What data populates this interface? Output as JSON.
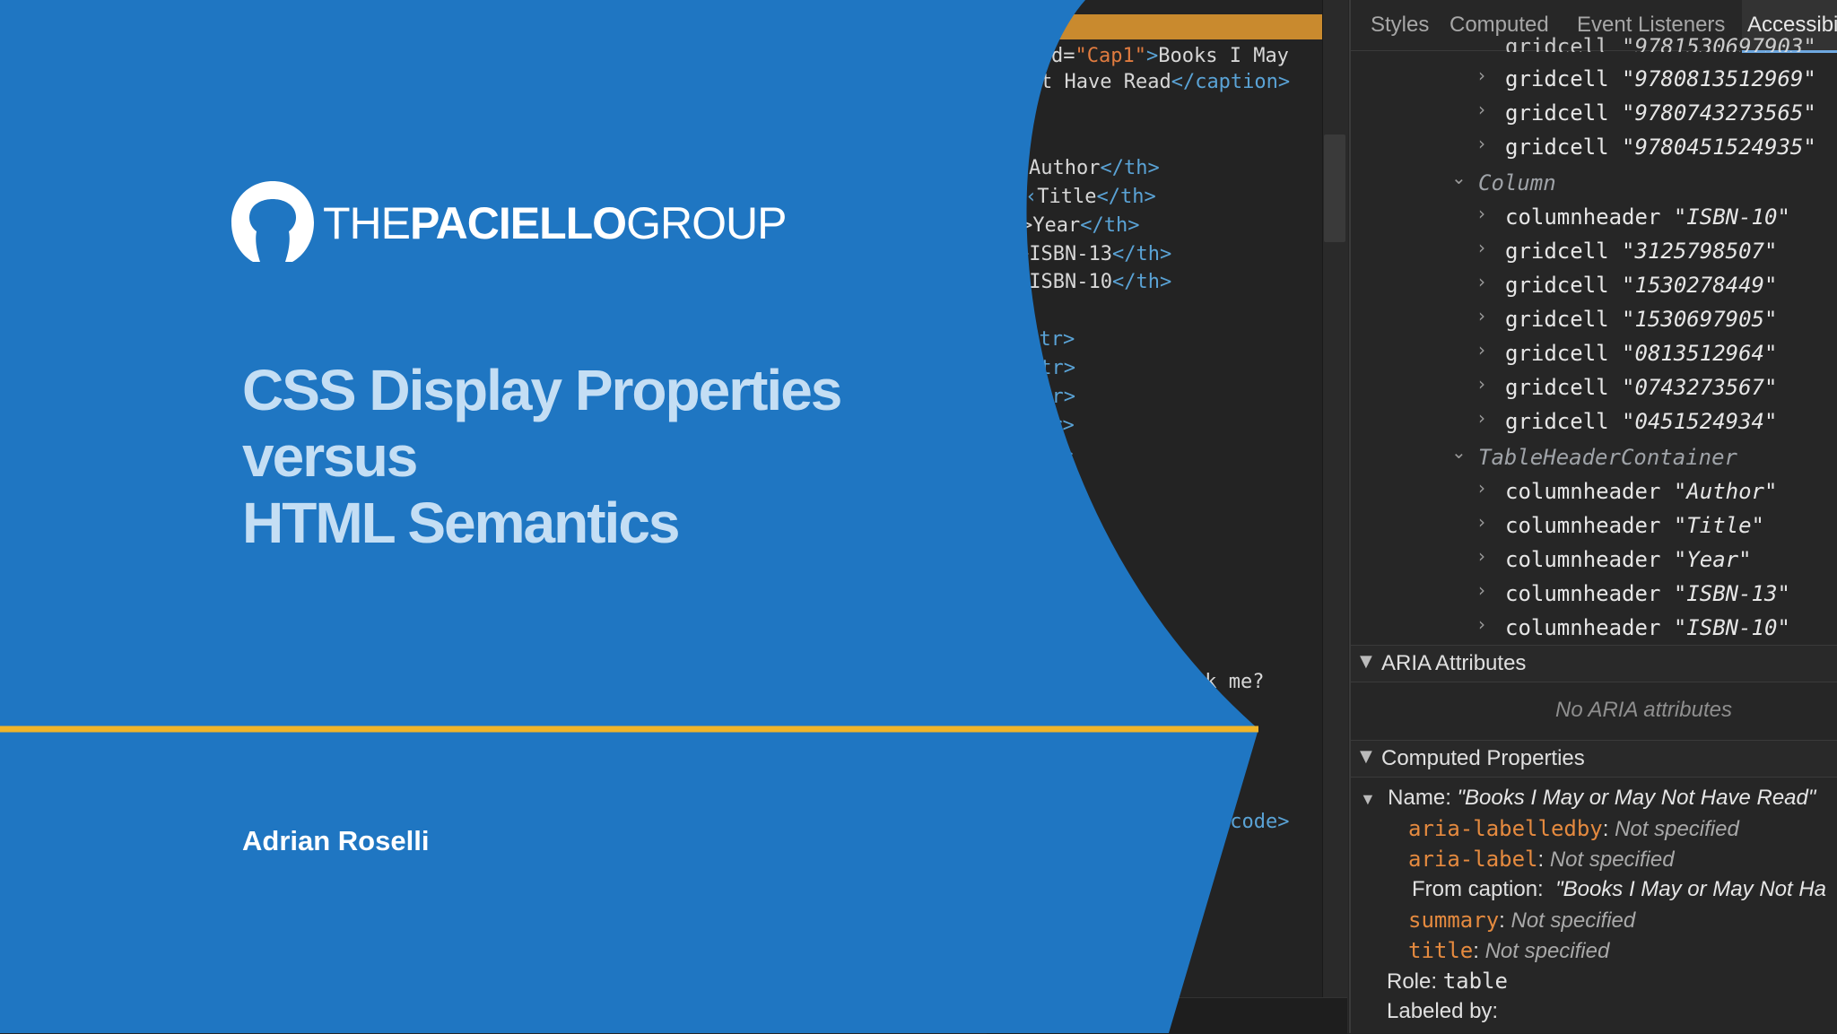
{
  "slide": {
    "brand": {
      "prefix": "THE",
      "bold": "PACIELLO",
      "suffix": "GROUP"
    },
    "title_lines": [
      "CSS Display Properties",
      "versus",
      "HTML Semantics"
    ],
    "author": "Adrian Roselli",
    "colors": {
      "background": "#1f76c2",
      "accent_line": "#f0b429",
      "title": "#c4def4"
    }
  },
  "code_editor": {
    "lines": [
      {
        "pre": "d=",
        "attr": "\"Cap1\"",
        "tag": ">",
        "text": "Books I May"
      },
      {
        "text": "t Have Read",
        "tag": "</caption>"
      },
      {
        "text": "Author",
        "tag": "</th>"
      },
      {
        "text": "Title",
        "tag": "</th>"
      },
      {
        "text": ">Year",
        "tag": "</th>"
      },
      {
        "text": ">ISBN-13",
        "tag": "</th>"
      },
      {
        "text": ">ISBN-10",
        "tag": "</th>"
      },
      {
        "tag": "</tr>"
      },
      {
        "tag": "/tr>"
      },
      {
        "tag": "/tr>"
      },
      {
        "tag": "tr>"
      },
      {
        "tag": "r>"
      },
      {
        "tag": ">"
      },
      {
        "text": "ck me?"
      },
      {
        "tag": "/code>"
      }
    ]
  },
  "devtools": {
    "tabs": [
      "Styles",
      "Computed",
      "Event Listeners",
      "Accessibi"
    ],
    "active_tab": "Accessibi",
    "tree": [
      {
        "role": "gridcell",
        "value": "\"9780813512969\""
      },
      {
        "role": "gridcell",
        "value": "\"9780743273565\""
      },
      {
        "role": "gridcell",
        "value": "\"9780451524935\""
      },
      {
        "role": "Column",
        "value": ""
      },
      {
        "role": "columnheader",
        "value": "\"ISBN-10\""
      },
      {
        "role": "gridcell",
        "value": "\"3125798507\""
      },
      {
        "role": "gridcell",
        "value": "\"1530278449\""
      },
      {
        "role": "gridcell",
        "value": "\"1530697905\""
      },
      {
        "role": "gridcell",
        "value": "\"0813512964\""
      },
      {
        "role": "gridcell",
        "value": "\"0743273567\""
      },
      {
        "role": "gridcell",
        "value": "\"0451524934\""
      },
      {
        "role": "TableHeaderContainer",
        "value": ""
      },
      {
        "role": "columnheader",
        "value": "\"Author\""
      },
      {
        "role": "columnheader",
        "value": "\"Title\""
      },
      {
        "role": "columnheader",
        "value": "\"Year\""
      },
      {
        "role": "columnheader",
        "value": "\"ISBN-13\""
      },
      {
        "role": "columnheader",
        "value": "\"ISBN-10\""
      }
    ],
    "aria_section": {
      "title": "ARIA Attributes",
      "empty_text": "No ARIA attributes"
    },
    "computed_section": {
      "title": "Computed Properties",
      "name_label": "Name:",
      "name_value": "\"Books I May or May Not Have Read\"",
      "props": [
        {
          "key": "aria-labelledby",
          "value": "Not specified"
        },
        {
          "key": "aria-label",
          "value": "Not specified"
        },
        {
          "key": "summary",
          "value": "Not specified"
        },
        {
          "key": "title",
          "value": "Not specified"
        }
      ],
      "from_caption_label": "From caption:",
      "from_caption_value": "\"Books I May or May Not Ha",
      "role_label": "Role:",
      "role_value": "table",
      "labeled_by_label": "Labeled by:"
    }
  }
}
